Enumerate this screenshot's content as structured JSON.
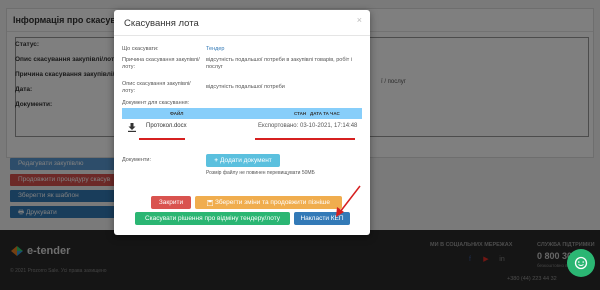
{
  "background": {
    "panel_title": "Інформація про скасуванн",
    "rows": [
      {
        "label": "Статус:"
      },
      {
        "label": "Опис скасування закупівлі/лоту:"
      },
      {
        "label": "Причина скасування закупівлі/лоту:"
      },
      {
        "label": "Дата:"
      },
      {
        "label": "Документи:"
      }
    ],
    "side_text": "ї / послуг",
    "buttons": [
      {
        "label": "Редагувати закупівлю",
        "color": "#5b9bd5"
      },
      {
        "label": "Продовжити процедуру скасув",
        "color": "#d9534f"
      },
      {
        "label": "Зберегти як шаблон",
        "color": "#337ab7"
      },
      {
        "label": "Друкувати",
        "color": "#337ab7"
      }
    ],
    "footer": {
      "logo": "e-tender",
      "copyright": "© 2021 Prozorro Sale. Усі права захищено",
      "social_title": "МИ В СОЦІАЛЬНИХ МЕРЕЖАХ",
      "support_title": "СЛУЖБА ПІДТРИМКИ",
      "phone": "0 800 30",
      "free_note": "безкоштовно в межах",
      "phone2": "+380 (44) 223 44 32"
    }
  },
  "modal": {
    "title": "Скасування лота",
    "close": "×",
    "fields": [
      {
        "label": "Що скасувати:",
        "value": "Тендер"
      },
      {
        "label": "Причина скасування закупівлі/лоту:",
        "value": "відсутність подальшої потреби в закупівлі товарів, робіт і послуг"
      },
      {
        "label": "Опис скасування закупівлі/лоту:",
        "value": "відсутність подальшої потреби"
      },
      {
        "label": "Документ для скасування:",
        "value": ""
      }
    ],
    "doc_table": {
      "headers": {
        "file": "ФАЙЛ",
        "status": "СТАН",
        "datetime": "ДАТА ТА ЧАС"
      },
      "row": {
        "file": "Протокол.docx",
        "status": "Експортовано:",
        "datetime": "03-10-2021, 17:14:48"
      }
    },
    "documents": {
      "label": "Документи:",
      "add_button": "Додати документ",
      "size_note": "Розмір файлу не повинен перевищувати 50МБ"
    },
    "buttons": {
      "close": "Закрити",
      "save_continue": "Зберегти зміни та продовжити пізніше",
      "cancel_decision": "Скасувати рішення про відміну тендеру/лоту",
      "sign": "Накласти КЕП"
    }
  }
}
